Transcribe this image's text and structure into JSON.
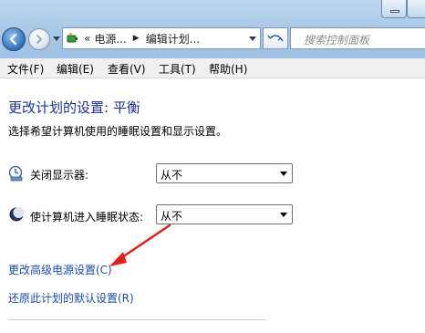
{
  "nav": {
    "address_prefix": "«",
    "breadcrumbs": [
      "电源...",
      "编辑计划..."
    ],
    "search_placeholder": "搜索控制面板"
  },
  "menu": {
    "items": [
      "文件(F)",
      "编辑(E)",
      "查看(V)",
      "工具(T)",
      "帮助(H)"
    ]
  },
  "page": {
    "title": "更改计划的设置: 平衡",
    "subtitle": "选择希望计算机使用的睡眠设置和显示设置。"
  },
  "settings": [
    {
      "label": "关闭显示器:",
      "value": "从不",
      "icon": "display-timer-icon"
    },
    {
      "label": "使计算机进入睡眠状态:",
      "value": "从不",
      "icon": "sleep-moon-icon"
    }
  ],
  "links": {
    "advanced": "更改高级电源设置(C)",
    "restore": "还原此计划的默认设置(R)"
  },
  "colors": {
    "title": "#1e3287",
    "link": "#1d4da5",
    "annotation_arrow": "#e02020"
  }
}
